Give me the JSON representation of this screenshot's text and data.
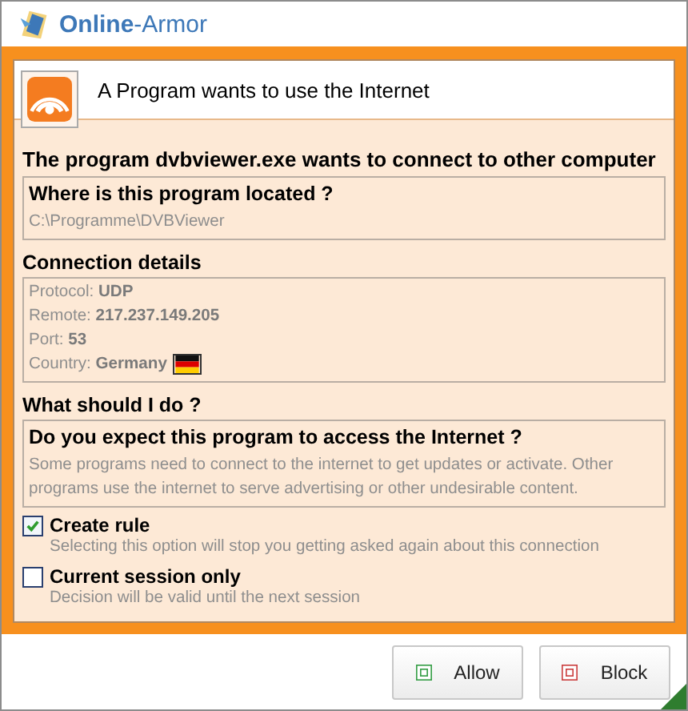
{
  "app": {
    "logo": "**Online**-Armor"
  },
  "header": {
    "title": "A Program wants to use the Internet"
  },
  "message": "The program dvbviewer.exe wants to connect to other computer",
  "location": {
    "heading": "Where is this program located ?",
    "path": "C:\\Programme\\DVBViewer"
  },
  "connection": {
    "heading": "Connection details",
    "details": [
      {
        "kind": "text",
        "text": "Protocol: **UDP**"
      },
      {
        "kind": "text",
        "text": "Remote: **217.237.149.205**"
      },
      {
        "kind": "text",
        "text": "Port: **53**"
      },
      {
        "kind": "country",
        "text": "Country: **Germany**"
      }
    ]
  },
  "decision": {
    "heading": "What should I do ?",
    "question": "Do you expect this program to access the Internet ?",
    "explanation": "Some programs need to connect to the internet to get updates or activate. Other programs use the internet to serve advertising or other undesirable content.",
    "options": [
      {
        "label": "Create rule",
        "description": "Selecting this option will stop you getting asked again about this connection",
        "checked": true
      },
      {
        "label": "Current session only",
        "description": "Decision will be valid until the next session",
        "checked": false
      }
    ]
  },
  "buttons": [
    {
      "label": "Allow",
      "kind": "allow"
    },
    {
      "label": "Block",
      "kind": "block"
    }
  ]
}
